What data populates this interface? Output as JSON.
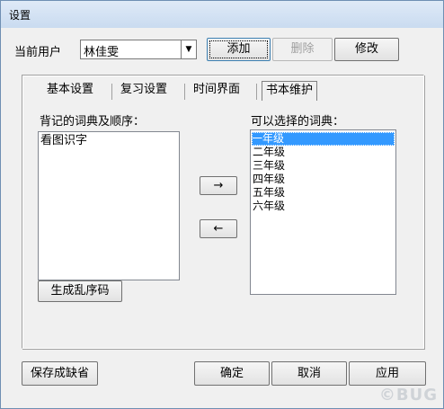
{
  "window": {
    "title": "设置"
  },
  "user": {
    "label": "当前用户",
    "value": "林佳雯"
  },
  "actions": {
    "add": "添加",
    "delete": "删除",
    "edit": "修改"
  },
  "tabs": [
    "基本设置",
    "复习设置",
    "时间界面",
    "书本维护"
  ],
  "left": {
    "label": "背记的词典及顺序：",
    "items": [
      "看图识字"
    ],
    "shuffle_button": "生成乱序码"
  },
  "right": {
    "label": "可以选择的词典：",
    "items": [
      "一年级",
      "二年级",
      "三年级",
      "四年级",
      "五年级",
      "六年级"
    ],
    "selected": "一年级"
  },
  "move": {
    "right_arrow": "→",
    "left_arrow": "←"
  },
  "footer": {
    "save_default": "保存成缺省",
    "ok": "确定",
    "cancel": "取消",
    "apply": "应用"
  },
  "watermark": "©BUG"
}
